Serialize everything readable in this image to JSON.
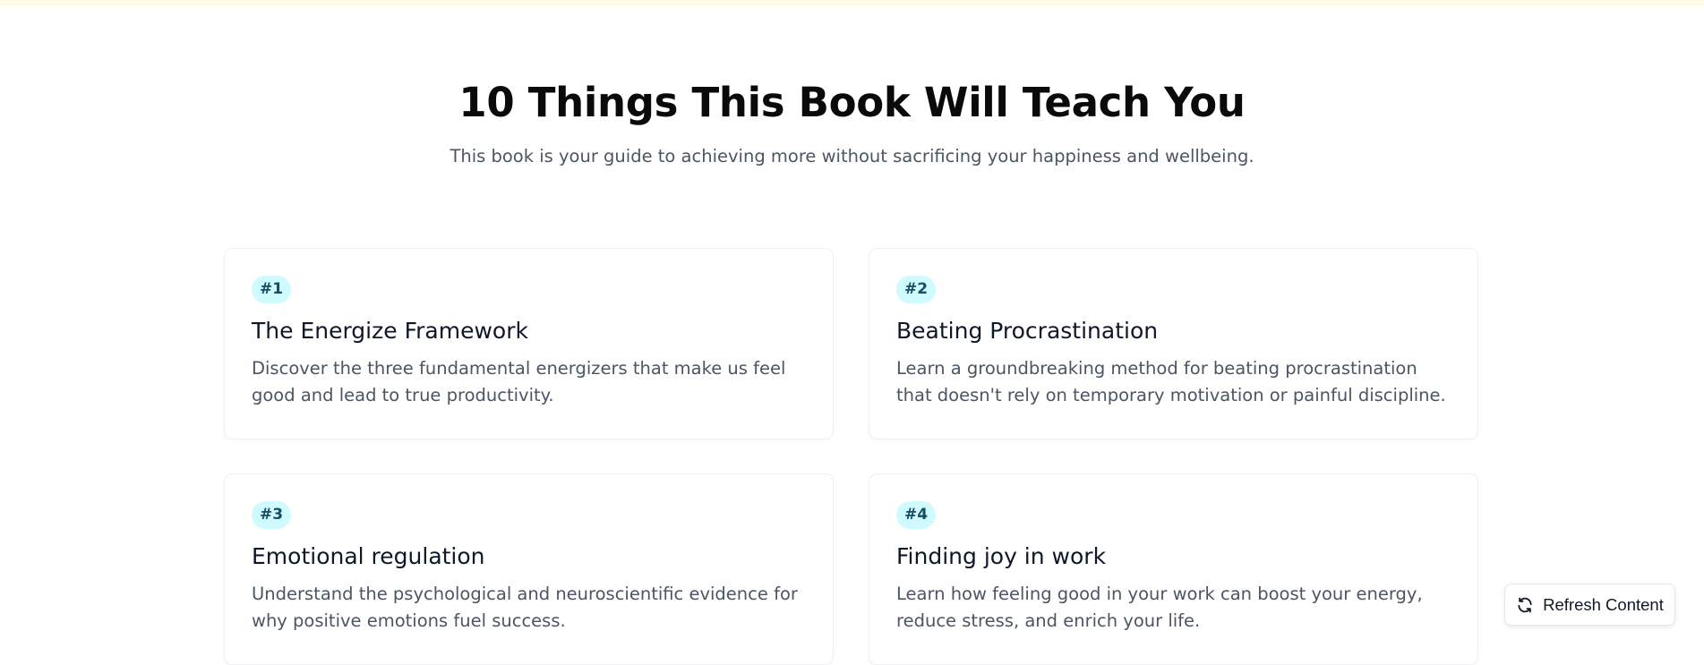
{
  "header": {
    "title": "10 Things This Book Will Teach You",
    "subtitle": "This book is your guide to achieving more without sacrificing your happiness and wellbeing."
  },
  "cards": [
    {
      "badge": "#1",
      "title": "The Energize Framework",
      "description": "Discover the three fundamental energizers that make us feel good and lead to true productivity."
    },
    {
      "badge": "#2",
      "title": "Beating Procrastination",
      "description": "Learn a groundbreaking method for beating procrastination that doesn't rely on temporary motivation or painful discipline."
    },
    {
      "badge": "#3",
      "title": "Emotional regulation",
      "description": "Understand the psychological and neuroscientific evidence for why positive emotions fuel success."
    },
    {
      "badge": "#4",
      "title": "Finding joy in work",
      "description": "Learn how feeling good in your work can boost your energy, reduce stress, and enrich your life."
    }
  ],
  "refresh": {
    "label": "Refresh Content",
    "icon": "refresh-icon"
  },
  "colors": {
    "badge_bg": "#cffafe",
    "badge_text": "#164e63",
    "top_strip": "#fefce8"
  }
}
